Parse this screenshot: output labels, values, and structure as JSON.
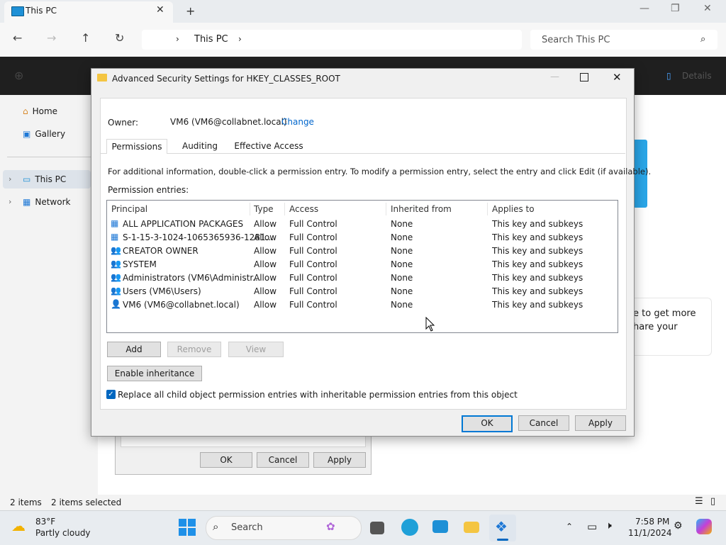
{
  "explorer": {
    "tab_title": "This PC",
    "breadcrumb": "This PC",
    "search_placeholder": "Search This PC",
    "sidebar": [
      {
        "label": "Home"
      },
      {
        "label": "Gallery"
      },
      {
        "label": "This PC"
      },
      {
        "label": "Network"
      }
    ],
    "details_label": "Details",
    "promo_line1": "e to get more",
    "promo_line2": "hare your",
    "status_items": "2 items",
    "status_selected": "2 items selected"
  },
  "bg_dialog": {
    "ok": "OK",
    "cancel": "Cancel",
    "apply": "Apply"
  },
  "dialog": {
    "title": "Advanced Security Settings for HKEY_CLASSES_ROOT",
    "owner_label": "Owner:",
    "owner_value": "VM6 (VM6@collabnet.local)",
    "change_link": "Change",
    "tabs": [
      "Permissions",
      "Auditing",
      "Effective Access"
    ],
    "info_text": "For additional information, double-click a permission entry. To modify a permission entry, select the entry and click Edit (if available).",
    "entries_label": "Permission entries:",
    "columns": [
      "Principal",
      "Type",
      "Access",
      "Inherited from",
      "Applies to"
    ],
    "rows": [
      {
        "principal": "ALL APPLICATION PACKAGES",
        "type": "Allow",
        "access": "Full Control",
        "inherited": "None",
        "applies": "This key and subkeys",
        "icon": "package"
      },
      {
        "principal": "S-1-15-3-1024-1065365936-1281...",
        "type": "Allow",
        "access": "Full Control",
        "inherited": "None",
        "applies": "This key and subkeys",
        "icon": "package"
      },
      {
        "principal": "CREATOR OWNER",
        "type": "Allow",
        "access": "Full Control",
        "inherited": "None",
        "applies": "This key and subkeys",
        "icon": "group"
      },
      {
        "principal": "SYSTEM",
        "type": "Allow",
        "access": "Full Control",
        "inherited": "None",
        "applies": "This key and subkeys",
        "icon": "group"
      },
      {
        "principal": "Administrators (VM6\\Administr...",
        "type": "Allow",
        "access": "Full Control",
        "inherited": "None",
        "applies": "This key and subkeys",
        "icon": "group"
      },
      {
        "principal": "Users (VM6\\Users)",
        "type": "Allow",
        "access": "Full Control",
        "inherited": "None",
        "applies": "This key and subkeys",
        "icon": "group"
      },
      {
        "principal": "VM6 (VM6@collabnet.local)",
        "type": "Allow",
        "access": "Full Control",
        "inherited": "None",
        "applies": "This key and subkeys",
        "icon": "user"
      }
    ],
    "add": "Add",
    "remove": "Remove",
    "view": "View",
    "enable_inheritance": "Enable inheritance",
    "replace_checkbox_label": "Replace all child object permission entries with inheritable permission entries from this object",
    "replace_checked": true,
    "ok": "OK",
    "cancel": "Cancel",
    "apply": "Apply"
  },
  "taskbar": {
    "temperature": "83°F",
    "weather": "Partly cloudy",
    "search_label": "Search",
    "time": "7:58 PM",
    "date": "11/1/2024"
  }
}
